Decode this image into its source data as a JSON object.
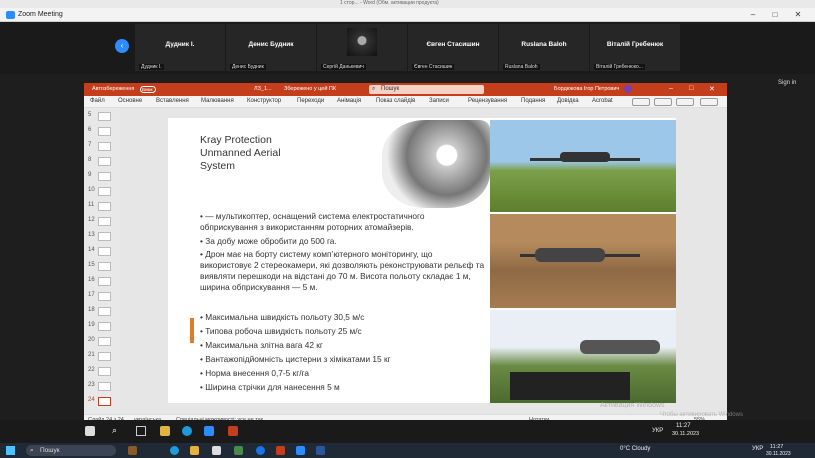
{
  "word_title": "1 стор... - Word (Обм. активации продукта)",
  "zoom": {
    "title": "Zoom Meeting",
    "participants": [
      {
        "name": "Дудник І.",
        "label": "Дудник І."
      },
      {
        "name": "Денис Будник",
        "label": "Денис Будник"
      },
      {
        "name": "",
        "label": "Сергій Данькевич"
      },
      {
        "name": "Євген Стасишин",
        "label": "Євген Стасишин"
      },
      {
        "name": "Ruslana Baloh",
        "label": "Ruslana Baloh"
      },
      {
        "name": "Віталій Гребенюк",
        "label": "Віталій Гребенюко..."
      }
    ],
    "sign_in": "Sign in"
  },
  "ppt": {
    "autosave": "Автозбереження",
    "toggle_state": "Вимк",
    "file_name": "ЛЗ_1...",
    "save_state": "Збережено у цей ПК",
    "search_placeholder": "Пошук",
    "user_name": "Бордюкова Ігор Петрович",
    "ribbon_tabs": [
      "Файл",
      "Основне",
      "Вставлення",
      "Малювання",
      "Конструктор",
      "Переходи",
      "Анімація",
      "Показ слайдів",
      "Записи",
      "Рецензування",
      "Подання",
      "Довідка",
      "Acrobat"
    ],
    "thumbnail_numbers": [
      "5",
      "6",
      "7",
      "8",
      "9",
      "10",
      "11",
      "12",
      "13",
      "14",
      "15",
      "16",
      "17",
      "18",
      "19",
      "20",
      "21",
      "22",
      "23",
      "24"
    ],
    "status_left": "Слайд 24 з 24",
    "status_lang": "українська",
    "status_access": "Спеціальні можливості: усе не так",
    "status_notes": "Нотатки",
    "zoom_level": "55%"
  },
  "slide": {
    "title_line1": "Kray Protection",
    "title_line2": "Unmanned Aerial",
    "title_line3": "System",
    "bullets_top": [
      "• — мультикоптер, оснащений система електростатичного обприскування з використанням роторних атомайзерів.",
      "• За добу може обробити до 500 га.",
      "• Дрон має на борту систему комп’ютерного моніторингу, що використовує 2 стереокамери, які дозволяють реконструювати рельєф та виявляти перешкоди на відстані до 70 м. Висота польоту складає 1 м, ширина обприскування — 5 м."
    ],
    "bullets_bottom": [
      "• Максимальна швидкість польоту 30,5 м/с",
      "• Типова робоча швидкість польоту 25 м/с",
      "• Максимальна злітна вага 42 кг",
      "• Вантажопідйомність цистерни з хімікатами 15 кг",
      "• Норма внесення 0,7-5 кг/га",
      "• Ширина стрічки для нанесення 5 м"
    ]
  },
  "watermark": {
    "line1": "Активация Windows",
    "line2": "Чтобы активировать Windows"
  },
  "taskbar": {
    "search": "Пошук",
    "weather": "0°C Cloudy",
    "lang": "УКР",
    "time": "11:27",
    "date": "30.11.2023"
  }
}
